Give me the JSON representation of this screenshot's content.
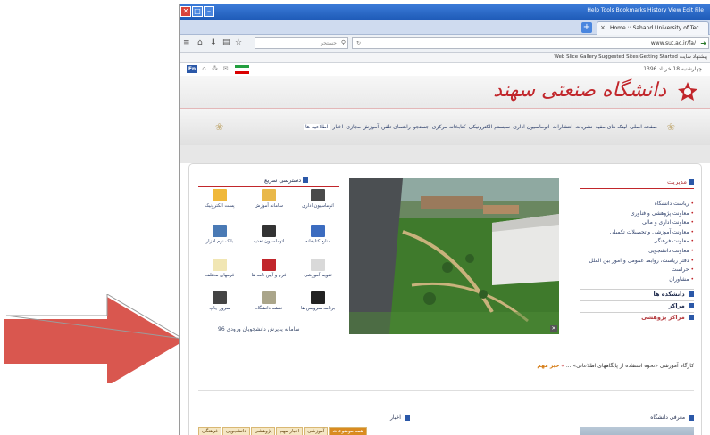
{
  "colors": {
    "accent_red": "#c1262b",
    "link_blue": "#2d3f6a",
    "arrow": "#d9574f"
  },
  "browser": {
    "title_menu": "Help  Tools  Bookmarks  History  View  Edit  File",
    "tab_title": "Home :: Sahand University of Tec",
    "tab_close": "×",
    "new_tab": "+",
    "search_placeholder": "جستجو",
    "url": "www.sut.ac.ir/fa/",
    "bookmarks": "Web Slice Gallery  Suggested Sites  Getting Started  پیشنهاد سایت"
  },
  "site": {
    "lang_button": "En",
    "date": "چهارشنبه 18 خرداد 1396",
    "logo_text": "دانشگاه صنعتی سهند",
    "nav": [
      "صفحه اصلی",
      "لینک های مفید",
      "نشریات",
      "انتشارات",
      "اتوماسیون اداری",
      "سیستم الکترونیکی",
      "کتابخانه مرکزی",
      "جستجو",
      "راهنمای تلفن",
      "آموزش مجازی",
      "اخبار",
      "اطلاعیه ها"
    ],
    "management": {
      "title": "مدیریت",
      "items": [
        "ریاست دانشگاه",
        "معاونت پژوهشی و فناوری",
        "معاونت اداری و مالی",
        "معاونت آموزشی و تحصیلات تکمیلی",
        "معاونت فرهنگی",
        "معاونت دانشجویی",
        "دفتر ریاست، روابط عمومی و امور بین الملل",
        "حراست",
        "مشاوران"
      ]
    },
    "sections": [
      "دانشکده ها",
      "مراکز",
      "مراکز پژوهشی"
    ],
    "quick_access": {
      "title": "دسترسی سریع",
      "items": [
        {
          "label": "اتوماسیون اداری",
          "icon": "automation-icon"
        },
        {
          "label": "سامانه آموزش",
          "icon": "education-system-icon"
        },
        {
          "label": "پست الکترونیک",
          "icon": "email-icon"
        },
        {
          "label": "منابع کتابخانه",
          "icon": "library-icon"
        },
        {
          "label": "اتوماسیون تغذیه",
          "icon": "food-icon"
        },
        {
          "label": "بانک نرم افزار",
          "icon": "software-bank-icon"
        },
        {
          "label": "تقویم آموزشی",
          "icon": "calendar-icon"
        },
        {
          "label": "فرم و آیین نامه ها",
          "icon": "regulations-icon"
        },
        {
          "label": "فرمهای مختلف",
          "icon": "forms-icon"
        },
        {
          "label": "برنامه سرویس ها",
          "icon": "bus-icon"
        },
        {
          "label": "نقشه دانشگاه",
          "icon": "map-icon"
        },
        {
          "label": "سرور چاپ",
          "icon": "printer-icon"
        }
      ],
      "more": "سامانه پذیرش دانشجویان ورودی 96"
    },
    "news_label": "خبر مهم",
    "news_text": "کارگاه آموزشی «نحوه استفاده از پایگاههای اطلاعاتی» ...",
    "intro_title": "معرفی دانشگاه",
    "news_box_title": "اخبار",
    "bottom_tabs": [
      "همه موضوعات",
      "آموزشی",
      "اخبار مهم",
      "پژوهشی",
      "دانشجویی",
      "فرهنگی"
    ]
  }
}
